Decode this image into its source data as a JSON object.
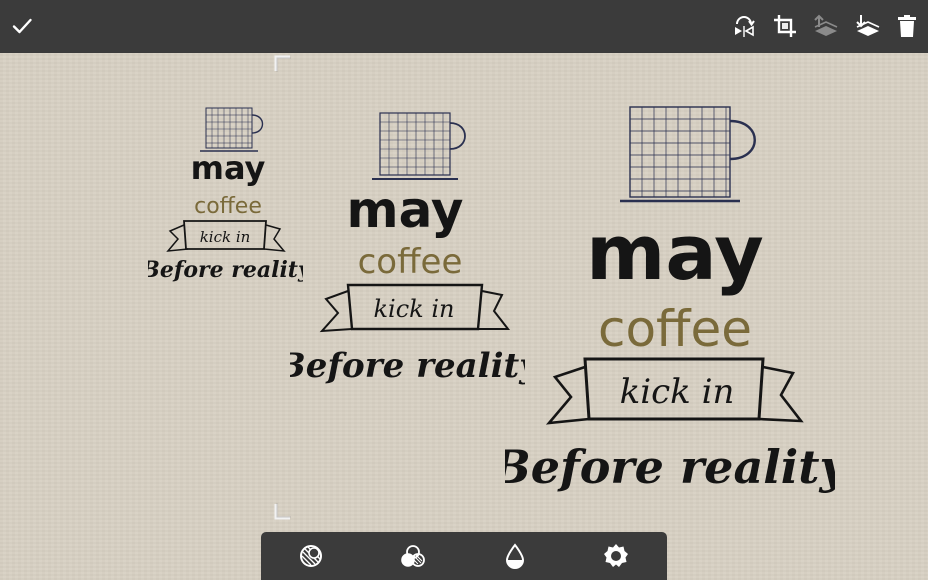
{
  "toolbar": {
    "confirm_icon": "checkmark-icon",
    "actions": [
      "flip-icon",
      "crop-icon",
      "move-layer-up-icon",
      "move-layer-down-icon",
      "trash-icon"
    ]
  },
  "artwork": {
    "line1": "may",
    "line2": "coffee",
    "line3": "kick in",
    "line4": "Before reality"
  },
  "bottom_tools": [
    "blend-icon",
    "opacity-circles-icon",
    "droplet-icon",
    "gear-icon"
  ],
  "colors": {
    "bar": "#3b3b3b",
    "canvas": "#d8d1c4",
    "ink": "#151515",
    "coffee": "#7a6a3a",
    "cup": "#2a3050"
  }
}
